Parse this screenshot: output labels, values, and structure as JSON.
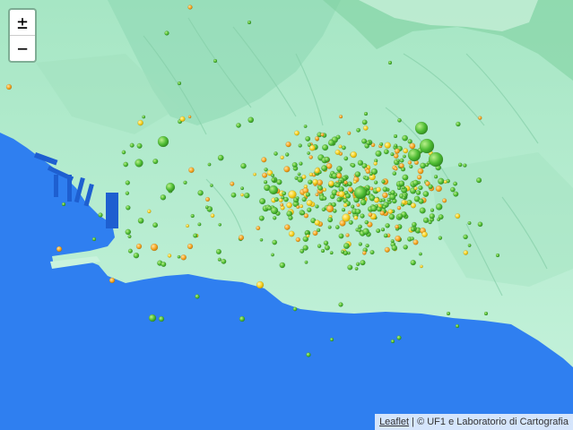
{
  "map": {
    "zoom_in_label": "±",
    "zoom_out_label": "−",
    "attribution": {
      "link_text": "Leaflet",
      "separator": " | ",
      "credit": "© UF1 e Laboratorio di Cartografia"
    },
    "colors": {
      "sea": "#2f7ff0",
      "land": "#b6ecd1",
      "land_shade": "#8fd9b4",
      "hills": "#7ecf9f",
      "marker_green": "#4fbd34",
      "marker_orange": "#f5a623",
      "marker_yellow": "#f7d11f"
    },
    "icons": {
      "zoom_in": "plus-icon",
      "zoom_out": "minus-icon",
      "marker": "circle-marker-icon"
    }
  }
}
